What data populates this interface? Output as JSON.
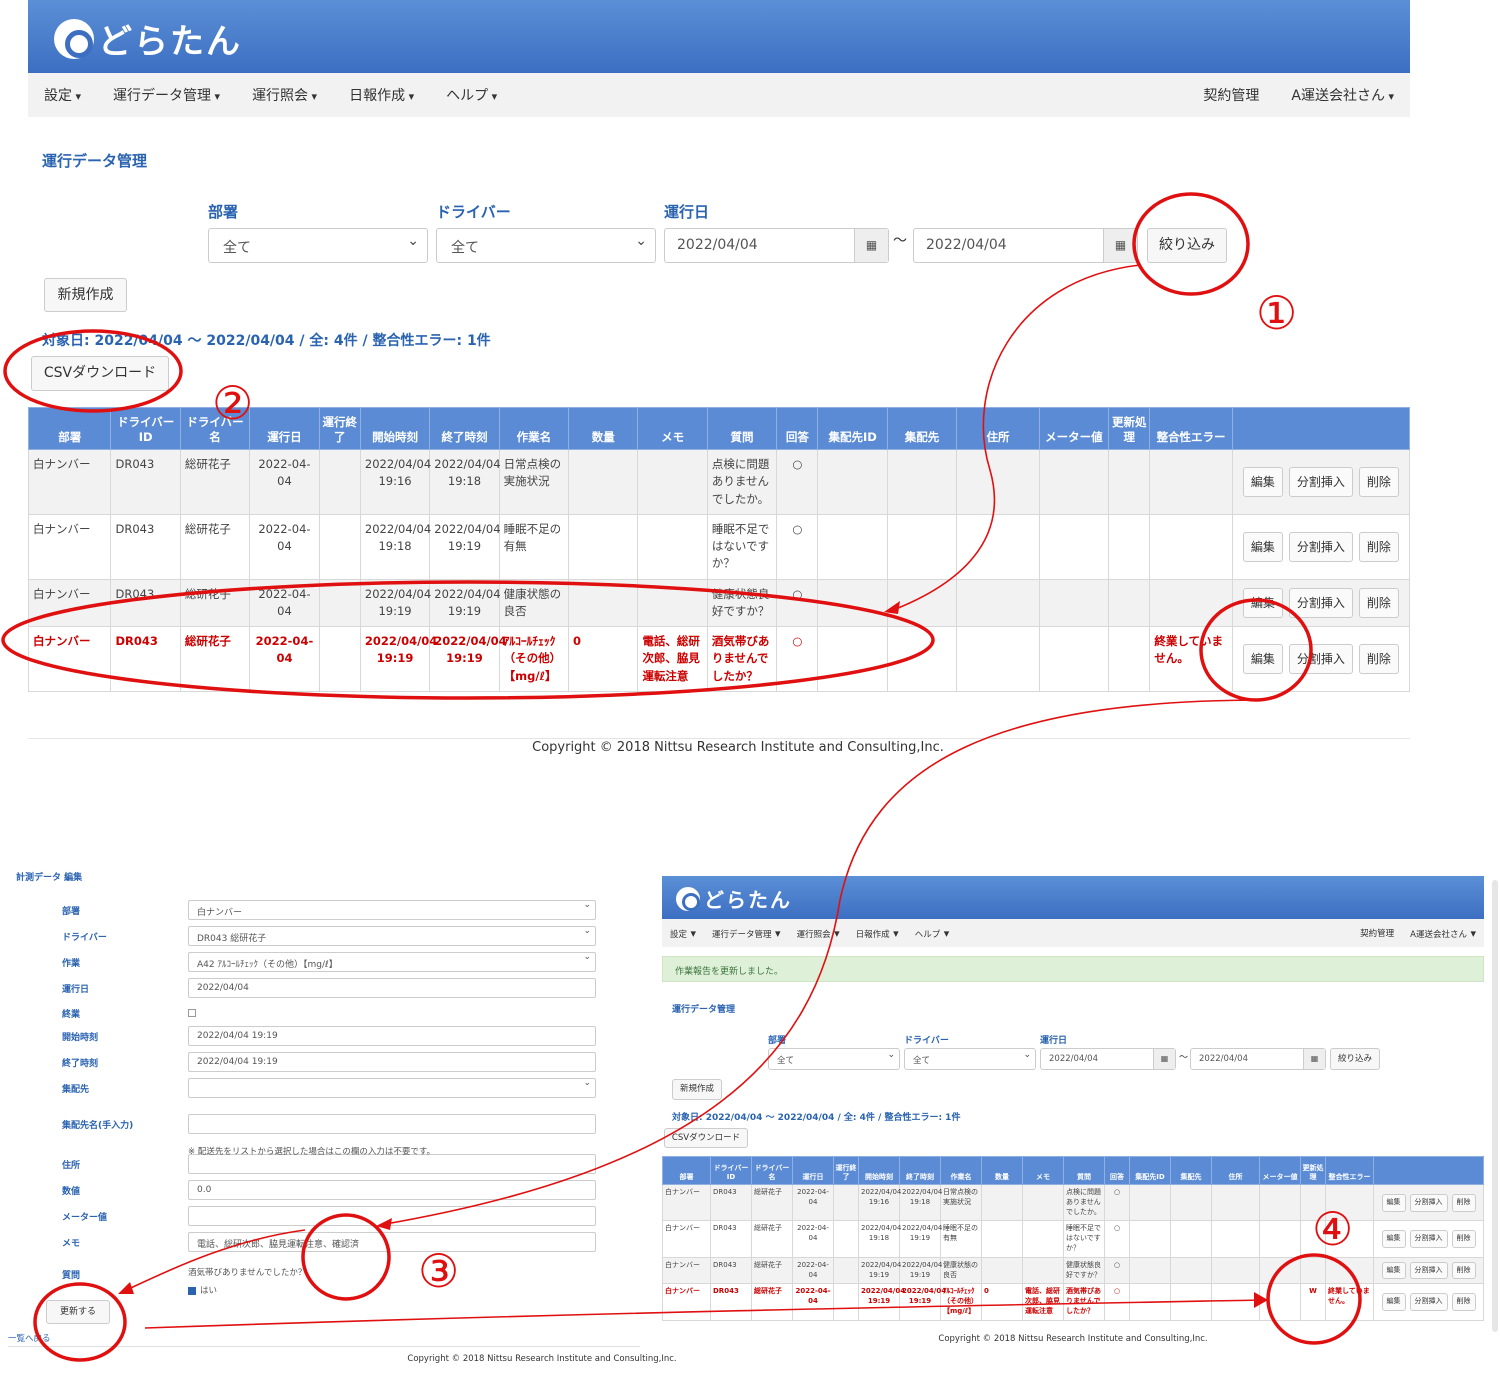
{
  "brand": {
    "name": "どらたん",
    "color": "#3c6fc2"
  },
  "nav": {
    "left": [
      "設定",
      "運行データ管理",
      "運行照会",
      "日報作成",
      "ヘルプ"
    ],
    "contract": "契約管理",
    "account": "A運送会社さん"
  },
  "main": {
    "title": "運行データ管理",
    "filters": {
      "dept_label": "部署",
      "dept_value": "全て",
      "driver_label": "ドライバー",
      "driver_value": "全て",
      "date_label": "運行日",
      "date_from": "2022/04/04",
      "tilde": "〜",
      "date_to": "2022/04/04"
    },
    "filter_button": "絞り込み",
    "new_button": "新規作成",
    "summary": "対象日: 2022/04/04 〜 2022/04/04 / 全: 4件 / 整合性エラー: 1件",
    "csv_button": "CSVダウンロード",
    "headers": [
      "部署",
      "ドライバーID",
      "ドライバー名",
      "運行日",
      "運行終了",
      "開始時刻",
      "終了時刻",
      "作業名",
      "数量",
      "メモ",
      "質問",
      "回答",
      "集配先ID",
      "集配先",
      "住所",
      "メーター値",
      "更新処理",
      "整合性エラー",
      ""
    ],
    "rows": [
      {
        "dept": "白ナンバー",
        "driver_id": "DR043",
        "driver_name": "総研花子",
        "date": "2022-04-04",
        "end": "",
        "start_time": "2022/04/04 19:16",
        "end_time": "2022/04/04 19:18",
        "task": "日常点検の実施状況",
        "qty": "",
        "memo": "",
        "question": "点検に問題ありませんでしたか。",
        "answer": "○",
        "dest_id": "",
        "dest": "",
        "address": "",
        "meter": "",
        "update": "",
        "error": ""
      },
      {
        "dept": "白ナンバー",
        "driver_id": "DR043",
        "driver_name": "総研花子",
        "date": "2022-04-04",
        "end": "",
        "start_time": "2022/04/04 19:18",
        "end_time": "2022/04/04 19:19",
        "task": "睡眠不足の有無",
        "qty": "",
        "memo": "",
        "question": "睡眠不足ではないですか？",
        "answer": "○",
        "dest_id": "",
        "dest": "",
        "address": "",
        "meter": "",
        "update": "",
        "error": ""
      },
      {
        "dept": "白ナンバー",
        "driver_id": "DR043",
        "driver_name": "総研花子",
        "date": "2022-04-04",
        "end": "",
        "start_time": "2022/04/04 19:19",
        "end_time": "2022/04/04 19:19",
        "task": "健康状態の良否",
        "qty": "",
        "memo": "",
        "question": "健康状態良好ですか？",
        "answer": "○",
        "dest_id": "",
        "dest": "",
        "address": "",
        "meter": "",
        "update": "",
        "error": ""
      },
      {
        "dept": "白ナンバー",
        "driver_id": "DR043",
        "driver_name": "総研花子",
        "date": "2022-04-04",
        "end": "",
        "start_time": "2022/04/04 19:19",
        "end_time": "2022/04/04 19:19",
        "task": "ｱﾙｺｰﾙﾁｪｯｸ（その他）【mg/ℓ】",
        "qty": "0",
        "memo": "電話、総研次郎、脇見運転注意",
        "question": "酒気帯びありませんでしたか？",
        "answer": "○",
        "dest_id": "",
        "dest": "",
        "address": "",
        "meter": "",
        "update": "",
        "error": "終業していません。"
      }
    ],
    "row_buttons": {
      "edit": "編集",
      "split": "分割挿入",
      "delete": "削除"
    }
  },
  "copyright": "Copyright © 2018 Nittsu Research Institute and Consulting,Inc.",
  "edit": {
    "title": "計測データ 編集",
    "fields": [
      {
        "label": "部署",
        "value": "白ナンバー"
      },
      {
        "label": "ドライバー",
        "value": "DR043 総研花子"
      },
      {
        "label": "作業",
        "value": "A42 ｱﾙｺｰﾙﾁｪｯｸ（その他）【mg/ℓ】"
      },
      {
        "label": "運行日",
        "value": "2022/04/04"
      },
      {
        "label": "終業",
        "value": ""
      },
      {
        "label": "開始時刻",
        "value": "2022/04/04 19:19"
      },
      {
        "label": "終了時刻",
        "value": "2022/04/04 19:19"
      },
      {
        "label": "集配先",
        "value": ""
      },
      {
        "label": "集配先名(手入力)",
        "value": ""
      },
      {
        "label": "住所",
        "value": ""
      },
      {
        "label": "数値",
        "value": "0.0"
      },
      {
        "label": "メーター値",
        "value": ""
      },
      {
        "label": "メモ",
        "value": "電話、総研次郎、脇見運転注意、確認済"
      },
      {
        "label": "質問",
        "value": ""
      }
    ],
    "note": "※ 配送先をリストから選択した場合はこの欄の入力は不要です。",
    "question_text": "酒気帯びありませんでしたか？",
    "answer_label": "はい",
    "update_button": "更新する",
    "back_link": "一覧へ戻る"
  },
  "mini": {
    "alert": "作業報告を更新しました。",
    "update_mark": "W"
  },
  "annotation_color": "#e01010",
  "annotations": [
    "①",
    "②",
    "③",
    "④"
  ]
}
